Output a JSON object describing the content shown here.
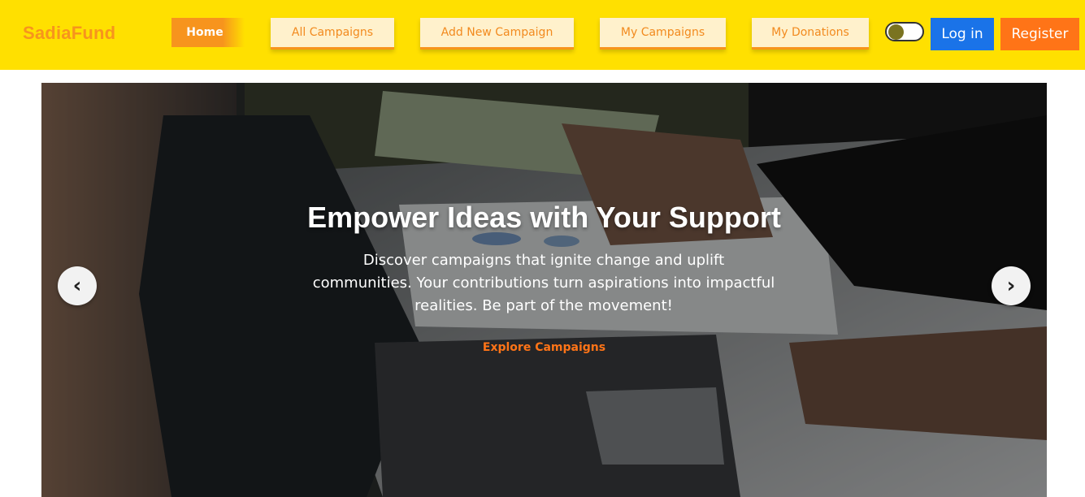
{
  "brand": "SadiaFund",
  "nav": {
    "home": "Home",
    "all_campaigns": "All Campaigns",
    "add_campaign": "Add New Campaign",
    "my_campaigns": "My Campaigns",
    "my_donations": "My Donations",
    "login": "Log in",
    "register": "Register"
  },
  "theme_toggle": {
    "state": "off"
  },
  "hero": {
    "title": "Empower Ideas with Your Support",
    "text_line1": "Discover campaigns that ignite change and uplift",
    "text_line2": "communities. Your contributions turn aspirations into impactful",
    "text_line3": "realities. Be part of the movement!",
    "cta": "Explore Campaigns",
    "prev": "‹",
    "next": "›"
  },
  "colors": {
    "navbar": "#ffe000",
    "accent": "#f7941d",
    "login": "#1a73e8",
    "register": "#ff7417"
  },
  "icons": {
    "prev": "chevron-left-icon",
    "next": "chevron-right-icon"
  }
}
